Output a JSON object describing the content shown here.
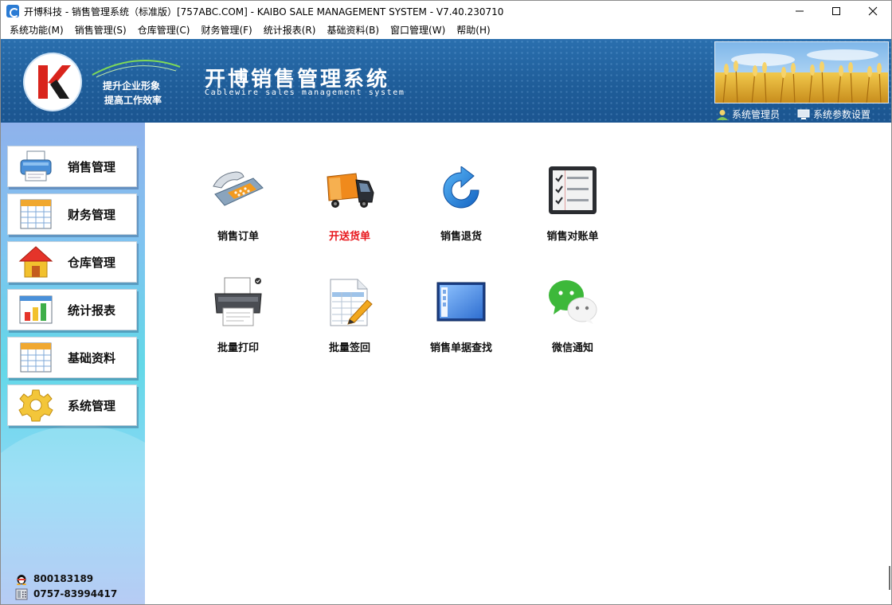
{
  "window": {
    "title": "开博科技 - 销售管理系统（标准版）[757ABC.COM] - KAIBO SALE MANAGEMENT SYSTEM - V7.40.230710"
  },
  "menu": [
    {
      "label": "系统功能(M)"
    },
    {
      "label": "销售管理(S)"
    },
    {
      "label": "仓库管理(C)"
    },
    {
      "label": "财务管理(F)"
    },
    {
      "label": "统计报表(R)"
    },
    {
      "label": "基础资料(B)"
    },
    {
      "label": "窗口管理(W)"
    },
    {
      "label": "帮助(H)"
    }
  ],
  "banner": {
    "slogan_line1": "提升企业形象",
    "slogan_line2": "提高工作效率",
    "title": "开博销售管理系统",
    "subtitle": "Cablewire sales management system",
    "user_link": "系统管理员",
    "settings_link": "系统参数设置"
  },
  "sidebar": {
    "items": [
      {
        "label": "销售管理",
        "icon": "printer-icon"
      },
      {
        "label": "财务管理",
        "icon": "spreadsheet-icon"
      },
      {
        "label": "仓库管理",
        "icon": "house-icon"
      },
      {
        "label": "统计报表",
        "icon": "bar-chart-icon"
      },
      {
        "label": "基础资料",
        "icon": "spreadsheet-icon"
      },
      {
        "label": "系统管理",
        "icon": "gear-icon"
      }
    ],
    "qq": "800183189",
    "phone": "0757-83994417"
  },
  "tiles": [
    {
      "label": "销售订单",
      "icon": "telephone-icon",
      "highlight": false
    },
    {
      "label": "开送货单",
      "icon": "truck-icon",
      "highlight": true
    },
    {
      "label": "销售退货",
      "icon": "refresh-arrow-icon",
      "highlight": false
    },
    {
      "label": "销售对账单",
      "icon": "checklist-icon",
      "highlight": false
    },
    {
      "label": "批量打印",
      "icon": "printer-icon",
      "highlight": false
    },
    {
      "label": "批量签回",
      "icon": "edit-sheet-icon",
      "highlight": false
    },
    {
      "label": "销售单据查找",
      "icon": "window-list-icon",
      "highlight": false
    },
    {
      "label": "微信通知",
      "icon": "wechat-icon",
      "highlight": false
    }
  ],
  "colors": {
    "banner": "#1f5d99",
    "highlight_text": "#e8191e"
  }
}
